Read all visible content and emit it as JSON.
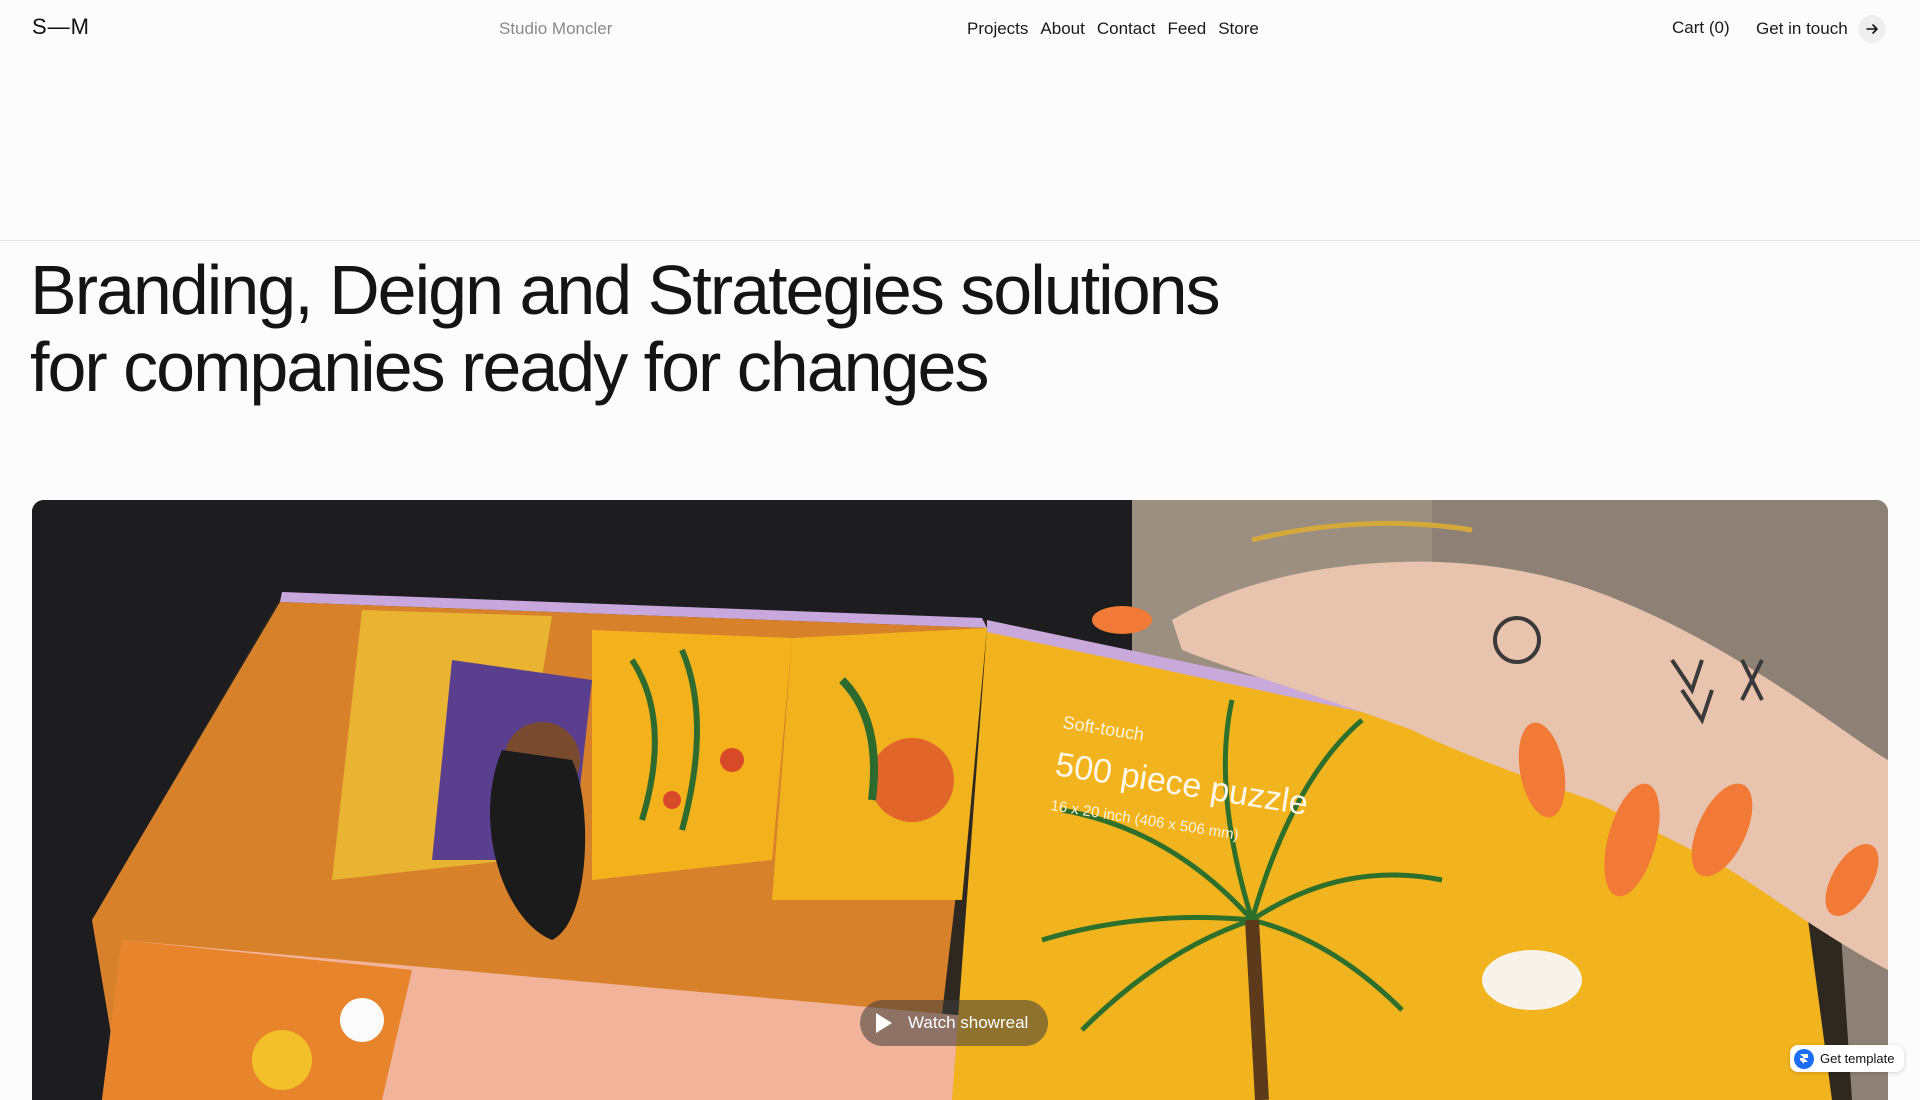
{
  "header": {
    "logo": "S—M",
    "studio_name": "Studio Moncler",
    "nav": [
      "Projects",
      "About",
      "Contact",
      "Feed",
      "Store"
    ],
    "cart_label": "Cart (0)",
    "cta_label": "Get in touch"
  },
  "hero": {
    "headline_line1": "Branding, Deign and Strategies solutions",
    "headline_line2": "for companies ready for changes",
    "image_text_1": "Soft-touch",
    "image_text_2": "500 piece puzzle",
    "image_text_3": "16 x 20 inch (406 x 506 mm)",
    "showreel_label": "Watch showreal"
  },
  "badge": {
    "label": "Get template"
  },
  "colors": {
    "background": "#fcfcfc",
    "text": "#141414",
    "muted": "#8a8a8a",
    "puzzle_yellow": "#f2b41e",
    "nail_orange": "#f07a36",
    "badge_blue": "#1b6ef3"
  },
  "icons": {
    "cta": "arrow-right-icon",
    "showreel": "play-icon",
    "badge": "framer-icon"
  }
}
